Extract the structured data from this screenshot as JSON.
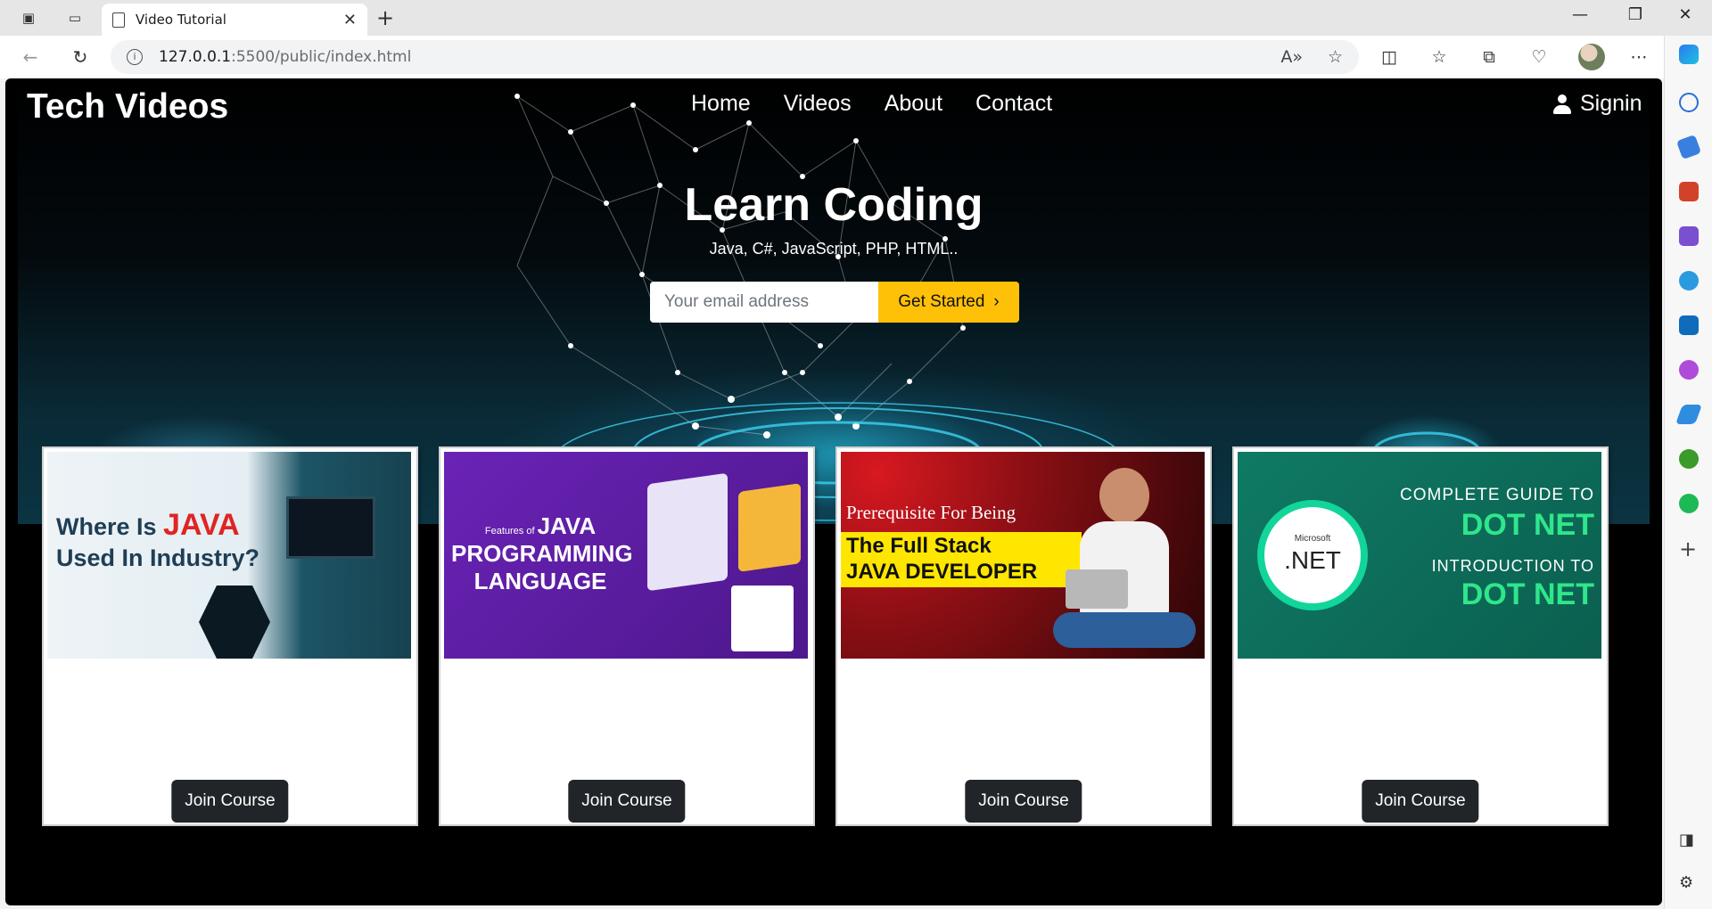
{
  "browser": {
    "tab_title": "Video Tutorial",
    "url_host": "127.0.0.1",
    "url_path": ":5500/public/index.html"
  },
  "site": {
    "brand": "Tech Videos",
    "nav": [
      "Home",
      "Videos",
      "About",
      "Contact"
    ],
    "signin": "Signin"
  },
  "hero": {
    "title": "Learn Coding",
    "subtitle": "Java, C#, JavaScript, PHP, HTML..",
    "email_placeholder": "Your email address",
    "cta": "Get Started"
  },
  "cards": [
    {
      "thumb_lines": [
        "Where Is ",
        "JAVA",
        "Used In Industry?"
      ],
      "button": "Join Course"
    },
    {
      "thumb_lines": [
        "Features of ",
        "JAVA",
        "PROGRAMMING",
        "LANGUAGE"
      ],
      "button": "Join Course"
    },
    {
      "thumb_lines": [
        "Prerequisite For Being",
        "The Full Stack",
        "JAVA DEVELOPER"
      ],
      "button": "Join Course"
    },
    {
      "thumb_lines": [
        "COMPLETE GUIDE TO",
        "DOT NET",
        "INTRODUCTION TO",
        "DOT NET",
        "Microsoft",
        ".NET"
      ],
      "button": "Join Course"
    }
  ],
  "colors": {
    "accent": "#ffc107",
    "button_dark": "#212529",
    "card2_bg": "#5a1fa0",
    "card3_bg": "#8a0f14",
    "card4_bg": "#0e6b5a"
  }
}
